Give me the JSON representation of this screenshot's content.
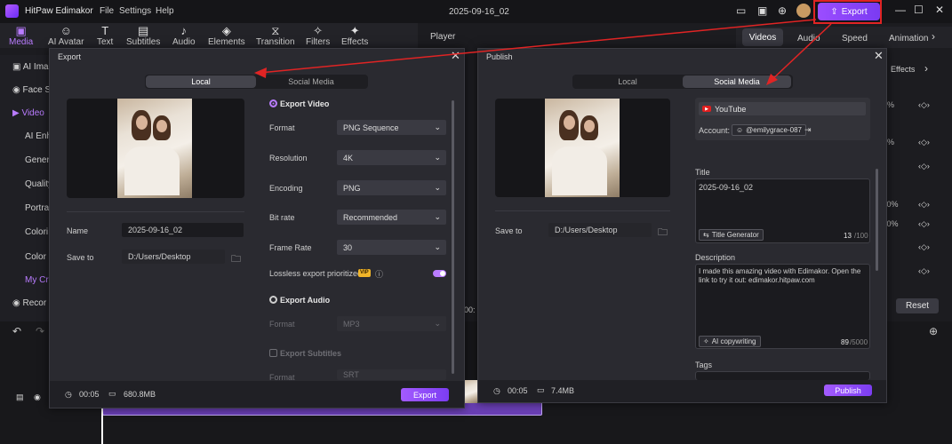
{
  "app": {
    "name": "HitPaw Edimakor",
    "project_title": "2025-09-16_02",
    "menus": [
      "File",
      "Settings",
      "Help"
    ],
    "export_label": "Export"
  },
  "toolbar": {
    "tools": [
      "Media",
      "AI Avatar",
      "Text",
      "Subtitles",
      "Audio",
      "Elements",
      "Transition",
      "Filters",
      "Effects"
    ]
  },
  "sidebar": {
    "items": [
      "AI Ima",
      "Face S",
      "Video",
      "AI Enh",
      "Gener",
      "Quality",
      "Portra",
      "Colori",
      "Color",
      "My Cr",
      "Recor"
    ]
  },
  "player": {
    "label": "Player"
  },
  "right_panel": {
    "tabs": [
      "Videos",
      "Audio",
      "Speed",
      "Animation"
    ],
    "sub_label": "Effects",
    "pct1": "%",
    "pct2": "%",
    "pct3": ".0%",
    "pct4": ".0%",
    "reset_label": "Reset"
  },
  "export_dialog": {
    "title": "Export",
    "tabs": {
      "local": "Local",
      "social": "Social Media"
    },
    "name_label": "Name",
    "name_value": "2025-09-16_02",
    "save_label": "Save to",
    "save_value": "D:/Users/Desktop",
    "export_video_label": "Export Video",
    "rows": [
      {
        "label": "Format",
        "value": "PNG Sequence"
      },
      {
        "label": "Resolution",
        "value": "4K"
      },
      {
        "label": "Encoding",
        "value": "PNG"
      },
      {
        "label": "Bit rate",
        "value": "Recommended"
      },
      {
        "label": "Frame Rate",
        "value": "30"
      }
    ],
    "lossless_label": "Lossless export prioritized",
    "vip": "VIP",
    "export_audio_label": "Export Audio",
    "audio_format_label": "Format",
    "audio_format_value": "MP3",
    "export_subtitles_label": "Export Subtitles",
    "sub_format_label": "Format",
    "sub_format_value": "SRT",
    "duration": "00:05",
    "size": "680.8MB",
    "export_button": "Export"
  },
  "publish_dialog": {
    "title": "Publish",
    "tabs": {
      "local": "Local",
      "social": "Social Media"
    },
    "save_label": "Save to",
    "save_value": "D:/Users/Desktop",
    "platform": "YouTube",
    "account_label": "Account:",
    "account_value": "@emilygrace-087",
    "title_label": "Title",
    "title_value": "2025-09-16_02",
    "title_gen": "Title Generator",
    "title_count": "13",
    "title_max": "/100",
    "desc_label": "Description",
    "desc_value": "I made this amazing video with Edimakor. Open the link to try it out: edimakor.hitpaw.com",
    "ai_copy": "AI copywriting",
    "desc_count": "89",
    "desc_max": "/5000",
    "tags_label": "Tags",
    "duration": "00:05",
    "size": "7.4MB",
    "publish_button": "Publish"
  },
  "timeline": {
    "time_frag": "00:"
  },
  "colors": {
    "accent": "#9b4dff",
    "highlight": "#e02424"
  }
}
